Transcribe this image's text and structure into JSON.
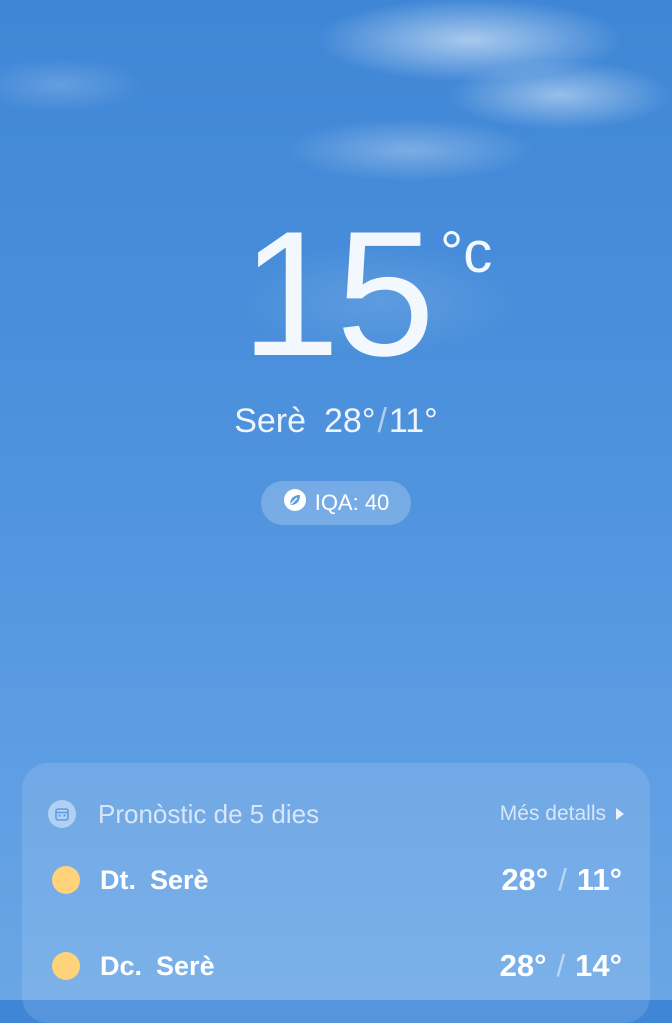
{
  "current": {
    "temperature": "15",
    "unit": "°c",
    "condition": "Serè",
    "high": "28°",
    "low": "11°",
    "separator": "/"
  },
  "aqi": {
    "label": "IQA: 40",
    "icon": "leaf-icon"
  },
  "forecast": {
    "title": "Pronòstic de 5 dies",
    "more_label": "Més detalls",
    "icon": "calendar-icon",
    "days": [
      {
        "day": "Dt.",
        "condition": "Serè",
        "high": "28°",
        "low": "11°",
        "separator": "/",
        "icon": "sun-icon"
      },
      {
        "day": "Dc.",
        "condition": "Serè",
        "high": "28°",
        "low": "14°",
        "separator": "/",
        "icon": "sun-icon"
      }
    ]
  },
  "colors": {
    "sky_top": "#3f86d6",
    "sky_bottom": "#6aa6e6",
    "sun": "#ffd37a"
  }
}
